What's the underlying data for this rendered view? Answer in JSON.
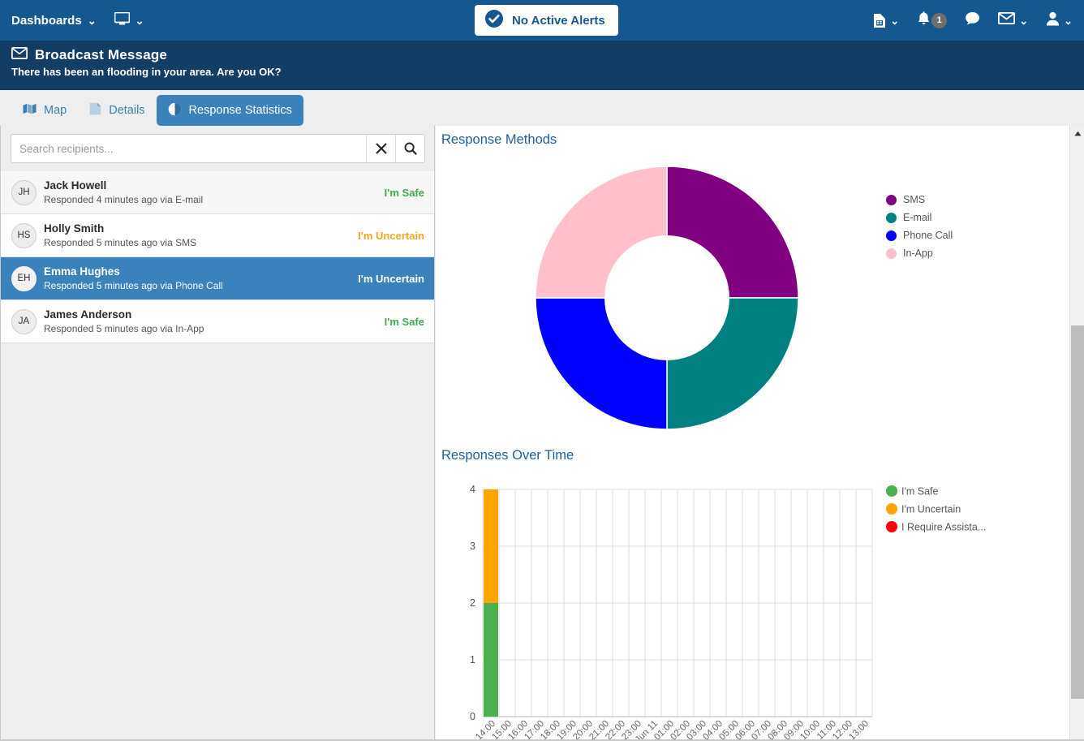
{
  "navbar": {
    "dashboards_label": "Dashboards",
    "dashboards_caret": "⌄",
    "monitor_icon": "monitor-icon",
    "monitor_caret": "⌄",
    "alert_status": "No Active Alerts",
    "alert_icon": "check-circle-icon",
    "right_icons": [
      {
        "name": "report-icon",
        "caret": "⌄"
      },
      {
        "name": "bell-icon",
        "badge": "1"
      },
      {
        "name": "chat-icon"
      },
      {
        "name": "envelope-icon",
        "caret": "⌄"
      },
      {
        "name": "user-icon",
        "caret": "⌄"
      }
    ],
    "colors": {
      "bar": "#15578f",
      "pill_text": "#15578f",
      "badge": "#6e6e6e"
    }
  },
  "banner": {
    "icon": "envelope-icon",
    "title": "Broadcast Message",
    "message": "There has been an flooding in your area. Are you OK?",
    "background": "#123e66"
  },
  "tabs": [
    {
      "label": "Map",
      "icon": "map-icon",
      "active": false
    },
    {
      "label": "Details",
      "icon": "document-icon",
      "active": false
    },
    {
      "label": "Response Statistics",
      "icon": "pie-chart-icon",
      "active": true
    }
  ],
  "search": {
    "placeholder": "Search recipients...",
    "value": "",
    "clear_icon": "close-icon",
    "search_icon": "search-icon"
  },
  "recipients": [
    {
      "initials": "JH",
      "name": "Jack Howell",
      "detail": "Responded 4 minutes ago via E-mail",
      "status": "I'm Safe",
      "status_color": "#3faa52",
      "selected": false
    },
    {
      "initials": "HS",
      "name": "Holly Smith",
      "detail": "Responded 5 minutes ago via SMS",
      "status": "I'm Uncertain",
      "status_color": "#f5a623",
      "selected": false
    },
    {
      "initials": "EH",
      "name": "Emma Hughes",
      "detail": "Responded 5 minutes ago via Phone Call",
      "status": "I'm Uncertain",
      "status_color": "#ffffff",
      "selected": true
    },
    {
      "initials": "JA",
      "name": "James Anderson",
      "detail": "Responded 5 minutes ago via In-App",
      "status": "I'm Safe",
      "status_color": "#3faa52",
      "selected": false
    }
  ],
  "chart_data": [
    {
      "type": "pie",
      "title": "Response Methods",
      "donut": true,
      "labels": [
        "SMS",
        "E-mail",
        "Phone Call",
        "In-App"
      ],
      "values": [
        25,
        25,
        25,
        25
      ],
      "colors": [
        "#800080",
        "#008080",
        "#0000ff",
        "#ffc0cb"
      ],
      "legend_position": "right",
      "xlabel": "",
      "ylabel": ""
    },
    {
      "type": "bar",
      "title": "Responses Over Time",
      "stacked": true,
      "categories": [
        "14:00",
        "15:00",
        "16:00",
        "17:00",
        "18:00",
        "19:00",
        "20:00",
        "21:00",
        "22:00",
        "23:00",
        "Jun 11",
        "01:00",
        "02:00",
        "03:00",
        "04:00",
        "05:00",
        "06:00",
        "07:00",
        "08:00",
        "09:00",
        "10:00",
        "11:00",
        "12:00",
        "13:00"
      ],
      "series": [
        {
          "name": "I'm Safe",
          "color": "#4caf50",
          "values": [
            2,
            0,
            0,
            0,
            0,
            0,
            0,
            0,
            0,
            0,
            0,
            0,
            0,
            0,
            0,
            0,
            0,
            0,
            0,
            0,
            0,
            0,
            0,
            0
          ]
        },
        {
          "name": "I'm Uncertain",
          "color": "#ffa500",
          "values": [
            2,
            0,
            0,
            0,
            0,
            0,
            0,
            0,
            0,
            0,
            0,
            0,
            0,
            0,
            0,
            0,
            0,
            0,
            0,
            0,
            0,
            0,
            0,
            0
          ]
        },
        {
          "name": "I Require Assista...",
          "color": "#ff0000",
          "values": [
            0,
            0,
            0,
            0,
            0,
            0,
            0,
            0,
            0,
            0,
            0,
            0,
            0,
            0,
            0,
            0,
            0,
            0,
            0,
            0,
            0,
            0,
            0,
            0
          ]
        }
      ],
      "yticks": [
        "0",
        "1",
        "2",
        "3",
        "4"
      ],
      "ylim": [
        0,
        4
      ],
      "grid": true,
      "legend_position": "right",
      "xlabel": "",
      "ylabel": ""
    }
  ],
  "scrollbar": {
    "up_arrow": "▲"
  }
}
